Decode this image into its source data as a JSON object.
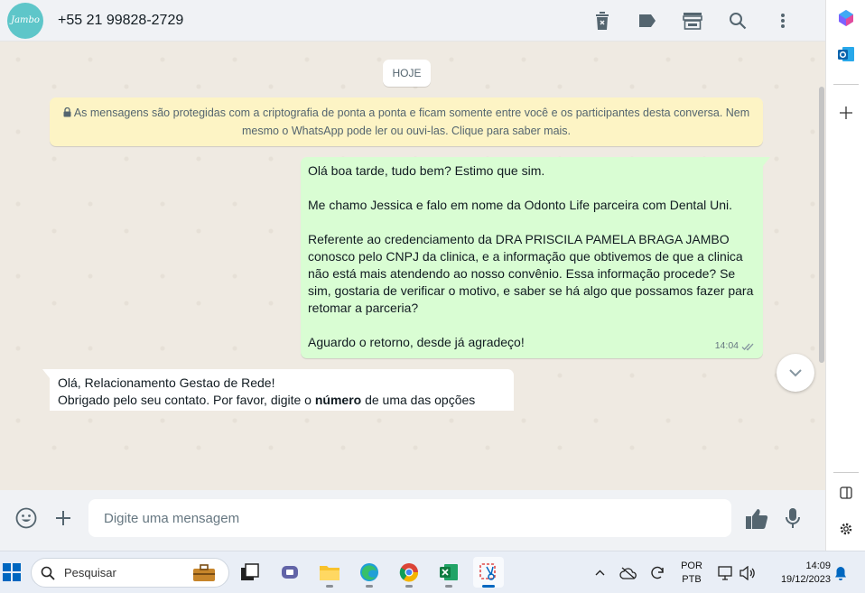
{
  "header": {
    "avatar_text": "Jambo",
    "contact_name": "+55 21 99828-2729",
    "icons": [
      "trash-icon",
      "label-icon",
      "store-icon",
      "search-icon",
      "menu-dots-icon"
    ]
  },
  "chat": {
    "date_chip": "HOJE",
    "encryption_notice": "As mensagens são protegidas com a criptografia de ponta a ponta e ficam somente entre você e os participantes desta conversa. Nem mesmo o WhatsApp pode ler ou ouvi-las. Clique para saber mais.",
    "outgoing": {
      "p1": "Olá boa tarde, tudo bem? Estimo que sim.",
      "p2": "Me chamo Jessica e falo em nome da Odonto Life parceira com Dental Uni.",
      "p3": "Referente ao credenciamento da DRA PRISCILA PAMELA BRAGA JAMBO conosco pelo CNPJ da clinica, e a informação que obtivemos de que a clinica não está mais atendendo ao nosso convênio. Essa informação procede? Se sim, gostaria de verificar o motivo, e saber se há algo que possamos fazer para retomar a parceria?",
      "p4": "Aguardo o retorno, desde já agradeço!",
      "time": "14:04"
    },
    "incoming": {
      "line1": "Olá, Relacionamento Gestao de Rede!",
      "line2_pre": "Obrigado pelo seu contato. Por favor, digite o ",
      "line2_bold": "número",
      "line2_post": " de uma das opções"
    }
  },
  "composer": {
    "placeholder": "Digite uma mensagem"
  },
  "taskbar": {
    "search_placeholder": "Pesquisar",
    "lang_1": "POR",
    "lang_2": "PTB",
    "time": "14:09",
    "date": "19/12/2023"
  },
  "colors": {
    "outgoing_bubble": "#d9fdd3",
    "encryption_bg": "#fdf4c5",
    "chat_bg": "#efeae2",
    "accent_teal": "#5ec6c9"
  }
}
